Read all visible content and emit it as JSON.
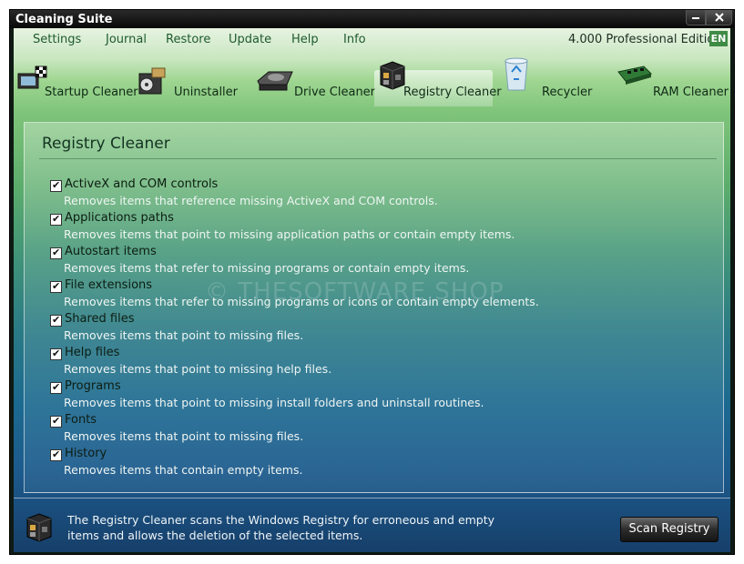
{
  "window": {
    "title": "Cleaning Suite"
  },
  "menu": {
    "items": [
      "Settings",
      "Journal",
      "Restore",
      "Update",
      "Help",
      "Info"
    ],
    "edition": "4.000 Professional Edition",
    "language": "EN"
  },
  "tabs": [
    {
      "label": "Startup Cleaner",
      "icon": "startup-icon"
    },
    {
      "label": "Uninstaller",
      "icon": "uninstaller-icon"
    },
    {
      "label": "Drive Cleaner",
      "icon": "drive-icon"
    },
    {
      "label": "Registry Cleaner",
      "icon": "registry-icon",
      "active": true
    },
    {
      "label": "Recycler",
      "icon": "recycle-bin-icon"
    },
    {
      "label": "RAM Cleaner",
      "icon": "ram-icon"
    }
  ],
  "panel": {
    "title": "Registry Cleaner",
    "options": [
      {
        "label": "ActiveX and COM controls",
        "desc": "Removes items that reference missing ActiveX and COM controls.",
        "checked": true
      },
      {
        "label": "Applications paths",
        "desc": "Removes items that point to missing application paths or contain empty items.",
        "checked": true
      },
      {
        "label": "Autostart items",
        "desc": "Removes items that refer to missing programs or contain empty items.",
        "checked": true
      },
      {
        "label": "File extensions",
        "desc": "Removes items that refer to missing programs or icons or contain empty elements.",
        "checked": true
      },
      {
        "label": "Shared files",
        "desc": "Removes items that point to missing files.",
        "checked": true
      },
      {
        "label": "Help files",
        "desc": "Removes items that point to missing help files.",
        "checked": true
      },
      {
        "label": "Programs",
        "desc": "Removes items that point to missing install folders and uninstall routines.",
        "checked": true
      },
      {
        "label": "Fonts",
        "desc": "Removes items that point to missing files.",
        "checked": true
      },
      {
        "label": "History",
        "desc": "Removes items that contain empty items.",
        "checked": true
      }
    ]
  },
  "footer": {
    "text": "The Registry Cleaner scans the Windows Registry for erroneous and empty items and allows the deletion of the selected items.",
    "scan_label": "Scan Registry"
  },
  "watermark": "© THESOFTWARE SHOP",
  "colors": {
    "accent_green": "#3f8a45",
    "menu_text": "#1e5a2e"
  }
}
